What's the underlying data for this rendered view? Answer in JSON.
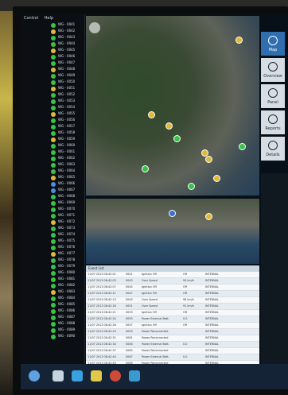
{
  "tree": {
    "menu": [
      "Control",
      "Help"
    ],
    "items": [
      {
        "label": "WG - 0041",
        "color": "#39c24a"
      },
      {
        "label": "WG - 0042",
        "color": "#e0b93a"
      },
      {
        "label": "WG - 0043",
        "color": "#39c24a"
      },
      {
        "label": "WG - 0044",
        "color": "#39c24a"
      },
      {
        "label": "WG - 0045",
        "color": "#e0b93a"
      },
      {
        "label": "WG - 0046",
        "color": "#39c24a"
      },
      {
        "label": "WG - 0047",
        "color": "#39c24a"
      },
      {
        "label": "WG - 0048",
        "color": "#e0b93a"
      },
      {
        "label": "WG - 0049",
        "color": "#39c24a"
      },
      {
        "label": "WG - 0050",
        "color": "#39c24a"
      },
      {
        "label": "WG - 0051",
        "color": "#e0b93a"
      },
      {
        "label": "WG - 0052",
        "color": "#39c24a"
      },
      {
        "label": "WG - 0053",
        "color": "#39c24a"
      },
      {
        "label": "WG - 0054",
        "color": "#39c24a"
      },
      {
        "label": "WG - 0055",
        "color": "#e0b93a"
      },
      {
        "label": "WG - 0056",
        "color": "#39c24a"
      },
      {
        "label": "WG - 0057",
        "color": "#39c24a"
      },
      {
        "label": "WG - 0058",
        "color": "#39c24a"
      },
      {
        "label": "WG - 0059",
        "color": "#e0b93a"
      },
      {
        "label": "WG - 0060",
        "color": "#39c24a"
      },
      {
        "label": "WG - 0061",
        "color": "#39c24a"
      },
      {
        "label": "WG - 0062",
        "color": "#39c24a"
      },
      {
        "label": "WG - 0063",
        "color": "#39c24a"
      },
      {
        "label": "WG - 0064",
        "color": "#39c24a"
      },
      {
        "label": "WG - 0065",
        "color": "#e0b93a"
      },
      {
        "label": "WG - 0066",
        "color": "#4a8fe0"
      },
      {
        "label": "WG - 0067",
        "color": "#4a8fe0"
      },
      {
        "label": "WG - 0068",
        "color": "#39c24a"
      },
      {
        "label": "WG - 0069",
        "color": "#39c24a"
      },
      {
        "label": "WG - 0070",
        "color": "#39c24a"
      },
      {
        "label": "WG - 0071",
        "color": "#39c24a"
      },
      {
        "label": "WG - 0072",
        "color": "#e0b93a"
      },
      {
        "label": "WG - 0073",
        "color": "#39c24a"
      },
      {
        "label": "WG - 0074",
        "color": "#39c24a"
      },
      {
        "label": "WG - 0075",
        "color": "#39c24a"
      },
      {
        "label": "WG - 0076",
        "color": "#39c24a"
      },
      {
        "label": "WG - 0077",
        "color": "#e0b93a"
      },
      {
        "label": "WG - 0078",
        "color": "#39c24a"
      },
      {
        "label": "WG - 0079",
        "color": "#39c24a"
      },
      {
        "label": "WG - 0080",
        "color": "#39c24a"
      },
      {
        "label": "WG - 0081",
        "color": "#39c24a"
      },
      {
        "label": "WG - 0082",
        "color": "#39c24a"
      },
      {
        "label": "WG - 0083",
        "color": "#e0b93a"
      },
      {
        "label": "WG - 0084",
        "color": "#39c24a"
      },
      {
        "label": "WG - 0085",
        "color": "#39c24a"
      },
      {
        "label": "WG - 0086",
        "color": "#39c24a"
      },
      {
        "label": "WG - 0087",
        "color": "#39c24a"
      },
      {
        "label": "WG - 0088",
        "color": "#39c24a"
      },
      {
        "label": "WG - 0089",
        "color": "#39c24a"
      },
      {
        "label": "WG - 0090",
        "color": "#39c24a"
      }
    ]
  },
  "nav": [
    {
      "label": "Map",
      "active": true
    },
    {
      "label": "Overview",
      "active": false
    },
    {
      "label": "Panel",
      "active": false
    },
    {
      "label": "Reports",
      "active": false
    },
    {
      "label": "Details",
      "active": false
    }
  ],
  "table": {
    "title": "Event List",
    "rows": [
      [
        "11/07 2013 08:42:01",
        "0041",
        "Ignition Off",
        "Off",
        "INTERNAL"
      ],
      [
        "11/07 2013 08:42:03",
        "0043",
        "Over Speed",
        "90 km/h",
        "INTERNAL"
      ],
      [
        "11/07 2013 08:42:07",
        "0045",
        "Ignition Off",
        "Off",
        "INTERNAL"
      ],
      [
        "11/07 2013 08:42:11",
        "0047",
        "Ignition Off",
        "Off",
        "INTERNAL"
      ],
      [
        "11/07 2013 08:42:13",
        "0049",
        "Over Speed",
        "98 km/h",
        "INTERNAL"
      ],
      [
        "11/07 2013 08:42:18",
        "0051",
        "Over Speed",
        "91 km/h",
        "INTERNAL"
      ],
      [
        "11/07 2013 08:42:21",
        "0053",
        "Ignition Off",
        "Off",
        "INTERNAL"
      ],
      [
        "11/07 2013 08:42:24",
        "0055",
        "Power External Batt.",
        "0.0",
        "INTERNAL"
      ],
      [
        "11/07 2013 08:42:26",
        "0057",
        "Ignition Off",
        "Off",
        "INTERNAL"
      ],
      [
        "11/07 2013 08:42:29",
        "0059",
        "Power Reconnected",
        "",
        "INTERNAL"
      ],
      [
        "11/07 2013 08:42:31",
        "0061",
        "Power Reconnected",
        "",
        "INTERNAL"
      ],
      [
        "11/07 2013 08:42:34",
        "0063",
        "Power External Batt.",
        "0.0",
        "INTERNAL"
      ],
      [
        "11/07 2013 08:42:37",
        "0065",
        "Power Reconnected",
        "",
        "INTERNAL"
      ],
      [
        "11/07 2013 08:42:40",
        "0067",
        "Power External Batt.",
        "0.0",
        "INTERNAL"
      ],
      [
        "11/07 2013 08:42:43",
        "0069",
        "Power Reconnected",
        "",
        "INTERNAL"
      ]
    ]
  },
  "colors": {
    "accent": "#2f6fb0"
  }
}
